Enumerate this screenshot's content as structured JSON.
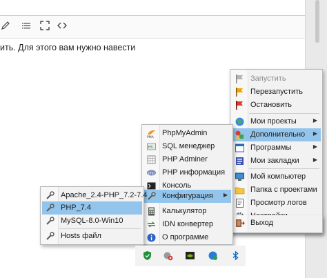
{
  "editor": {
    "text_line": "ить. Для этого вам нужно навести"
  },
  "main_menu": {
    "items": [
      {
        "label": "Запустить",
        "icon": "flag-gray-icon",
        "disabled": true
      },
      {
        "label": "Перезапустить",
        "icon": "flag-orange-icon"
      },
      {
        "label": "Остановить",
        "icon": "flag-red-icon"
      },
      {
        "label": "Мои проекты",
        "icon": "globe-icon",
        "submenu": true
      },
      {
        "label": "Дополнительно",
        "icon": "shapes-icon",
        "submenu": true,
        "highlighted": true
      },
      {
        "label": "Программы",
        "icon": "window-icon",
        "submenu": true
      },
      {
        "label": "Мои закладки",
        "icon": "bookmarks-icon",
        "submenu": true
      },
      {
        "label": "Мой компьютер",
        "icon": "monitor-icon"
      },
      {
        "label": "Папка с проектами",
        "icon": "folder-icon"
      },
      {
        "label": "Просмотр логов",
        "icon": "log-icon"
      },
      {
        "label": "Настройки",
        "icon": "gear-icon"
      },
      {
        "label": "Выход",
        "icon": "exit-icon"
      }
    ]
  },
  "extra_menu": {
    "items": [
      {
        "label": "PhpMyAdmin",
        "icon": "phpmyadmin-icon"
      },
      {
        "label": "SQL менеджер",
        "icon": "sql-manager-icon"
      },
      {
        "label": "PHP Adminer",
        "icon": "adminer-icon"
      },
      {
        "label": "PHP информация",
        "icon": "php-info-icon"
      },
      {
        "label": "Консоль",
        "icon": "console-icon"
      },
      {
        "label": "Конфигурация",
        "icon": "wrench-icon",
        "submenu": true,
        "highlighted": true
      },
      {
        "label": "Калькулятор",
        "icon": "calculator-icon"
      },
      {
        "label": "IDN конвертер",
        "icon": "idn-icon"
      },
      {
        "label": "О программе",
        "icon": "info-icon"
      }
    ]
  },
  "config_menu": {
    "items": [
      {
        "label": "Apache_2.4-PHP_7.2-7.4",
        "icon": "wrench-icon"
      },
      {
        "label": "PHP_7.4",
        "icon": "wrench-icon",
        "highlighted": true
      },
      {
        "label": "MySQL-8.0-Win10",
        "icon": "wrench-icon"
      },
      {
        "label": "Hosts файл",
        "icon": "wrench-icon"
      }
    ]
  },
  "tray": {
    "icons": [
      "defender-shield-icon",
      "speaker-muted-icon",
      "nvidia-icon",
      "network-icon",
      "bluetooth-icon"
    ]
  },
  "colors": {
    "highlight": "#93c5ec",
    "menu_bg": "#f2f2f2"
  }
}
